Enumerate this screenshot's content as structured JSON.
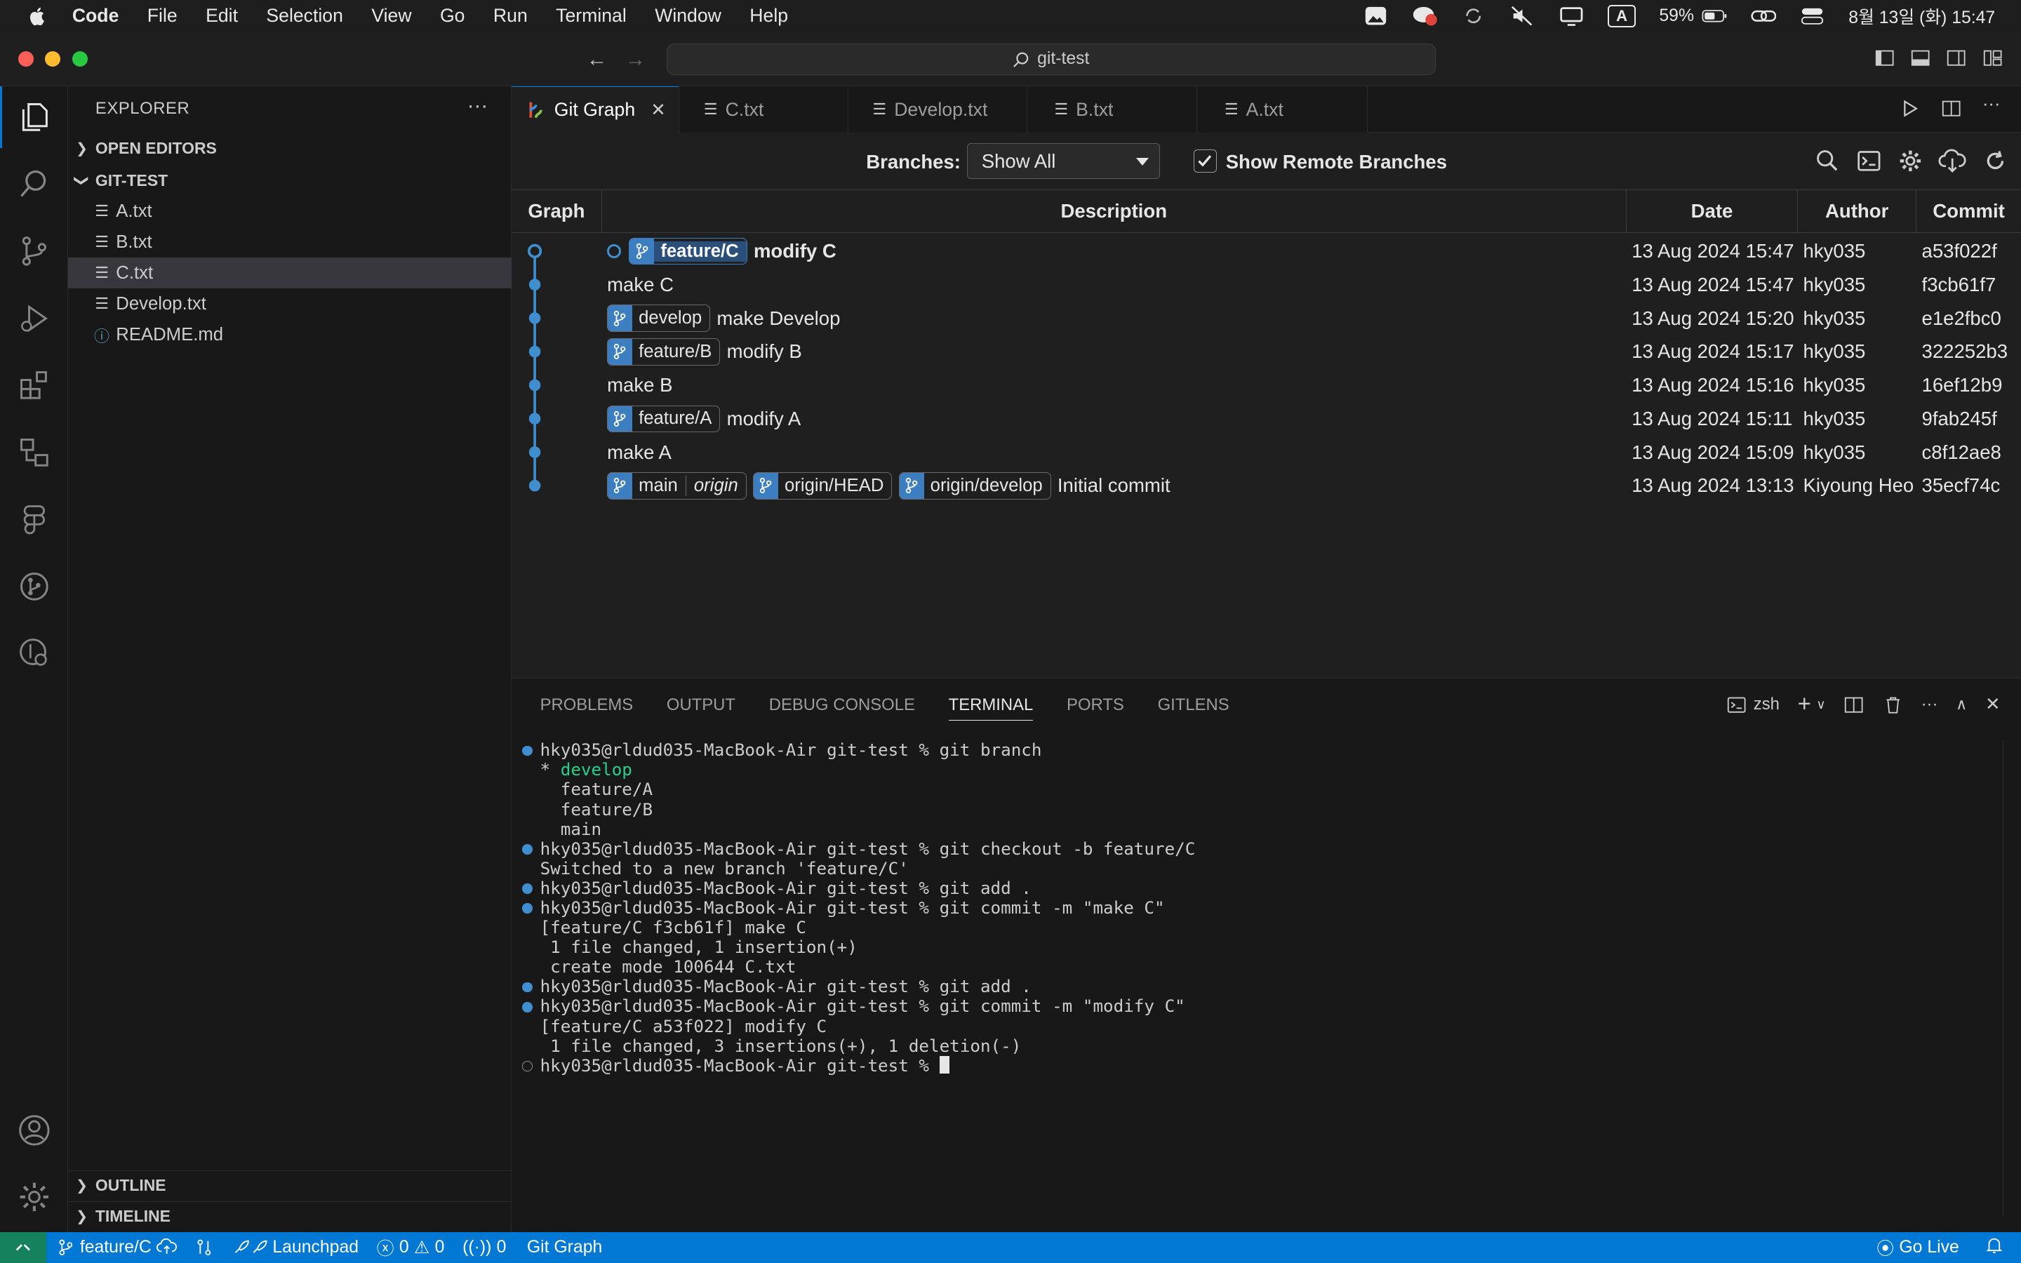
{
  "menubar": {
    "items": [
      "Code",
      "File",
      "Edit",
      "Selection",
      "View",
      "Go",
      "Run",
      "Terminal",
      "Window",
      "Help"
    ],
    "battery": "59%",
    "datetime": "8월 13일 (화) 15:47",
    "input_source": "A"
  },
  "titlebar": {
    "search_text": "git-test"
  },
  "sidebar": {
    "title": "EXPLORER",
    "open_editors": "OPEN EDITORS",
    "folder": "GIT-TEST",
    "files": [
      "A.txt",
      "B.txt",
      "C.txt",
      "Develop.txt",
      "README.md"
    ],
    "outline": "OUTLINE",
    "timeline": "TIMELINE"
  },
  "tabs": [
    "Git Graph",
    "C.txt",
    "Develop.txt",
    "B.txt",
    "A.txt"
  ],
  "gitgraph": {
    "branches_label": "Branches:",
    "branches_value": "Show All",
    "show_remote_label": "Show Remote Branches",
    "show_remote_checked": true,
    "columns": [
      "Graph",
      "Description",
      "Date",
      "Author",
      "Commit"
    ],
    "commits": [
      {
        "refs": [
          {
            "name": "feature/C",
            "head": true
          }
        ],
        "message": "modify C",
        "date": "13 Aug 2024 15:47",
        "author": "hky035",
        "hash": "a53f022f",
        "current": true
      },
      {
        "refs": [],
        "message": "make C",
        "date": "13 Aug 2024 15:47",
        "author": "hky035",
        "hash": "f3cb61f7"
      },
      {
        "refs": [
          {
            "name": "develop"
          }
        ],
        "message": "make Develop",
        "date": "13 Aug 2024 15:20",
        "author": "hky035",
        "hash": "e1e2fbc0"
      },
      {
        "refs": [
          {
            "name": "feature/B"
          }
        ],
        "message": "modify B",
        "date": "13 Aug 2024 15:17",
        "author": "hky035",
        "hash": "322252b3"
      },
      {
        "refs": [],
        "message": "make B",
        "date": "13 Aug 2024 15:16",
        "author": "hky035",
        "hash": "16ef12b9"
      },
      {
        "refs": [
          {
            "name": "feature/A"
          }
        ],
        "message": "modify A",
        "date": "13 Aug 2024 15:11",
        "author": "hky035",
        "hash": "9fab245f"
      },
      {
        "refs": [],
        "message": "make A",
        "date": "13 Aug 2024 15:09",
        "author": "hky035",
        "hash": "c8f12ae8"
      },
      {
        "refs": [
          {
            "name": "main",
            "remote": "origin"
          },
          {
            "name": "origin/HEAD"
          },
          {
            "name": "origin/develop"
          }
        ],
        "message": "Initial commit",
        "date": "13 Aug 2024 13:13",
        "author": "Kiyoung Heo",
        "hash": "35ecf74c"
      }
    ]
  },
  "panel": {
    "tabs": [
      "PROBLEMS",
      "OUTPUT",
      "DEBUG CONSOLE",
      "TERMINAL",
      "PORTS",
      "GITLENS"
    ],
    "active_tab": "TERMINAL",
    "shell": "zsh",
    "lines": [
      {
        "dot": "filled",
        "text": "hky035@rldud035-MacBook-Air git-test % git branch"
      },
      {
        "dot": "none",
        "prefix": "* ",
        "green": "develop",
        "text": ""
      },
      {
        "dot": "none",
        "text": "  feature/A"
      },
      {
        "dot": "none",
        "text": "  feature/B"
      },
      {
        "dot": "none",
        "text": "  main"
      },
      {
        "dot": "filled",
        "text": "hky035@rldud035-MacBook-Air git-test % git checkout -b feature/C"
      },
      {
        "dot": "none",
        "text": "Switched to a new branch 'feature/C'"
      },
      {
        "dot": "filled",
        "text": "hky035@rldud035-MacBook-Air git-test % git add ."
      },
      {
        "dot": "filled",
        "text": "hky035@rldud035-MacBook-Air git-test % git commit -m \"make C\""
      },
      {
        "dot": "none",
        "text": "[feature/C f3cb61f] make C"
      },
      {
        "dot": "none",
        "text": " 1 file changed, 1 insertion(+)"
      },
      {
        "dot": "none",
        "text": " create mode 100644 C.txt"
      },
      {
        "dot": "filled",
        "text": "hky035@rldud035-MacBook-Air git-test % git add ."
      },
      {
        "dot": "filled",
        "text": "hky035@rldud035-MacBook-Air git-test % git commit -m \"modify C\""
      },
      {
        "dot": "none",
        "text": "[feature/C a53f022] modify C"
      },
      {
        "dot": "none",
        "text": " 1 file changed, 3 insertions(+), 1 deletion(-)"
      },
      {
        "dot": "empty",
        "text": "hky035@rldud035-MacBook-Air git-test % ",
        "cursor": true
      }
    ]
  },
  "statusbar": {
    "branch": "feature/C",
    "launchpad": "Launchpad",
    "errors": "0",
    "warnings": "0",
    "ports": "0",
    "gitgraph": "Git Graph",
    "golive": "Go Live"
  },
  "colors": {
    "accent": "#0078d4",
    "graph": "#3f8fd0",
    "ref_icon": "#3c7ebf",
    "terminal_green": "#23d18b"
  }
}
